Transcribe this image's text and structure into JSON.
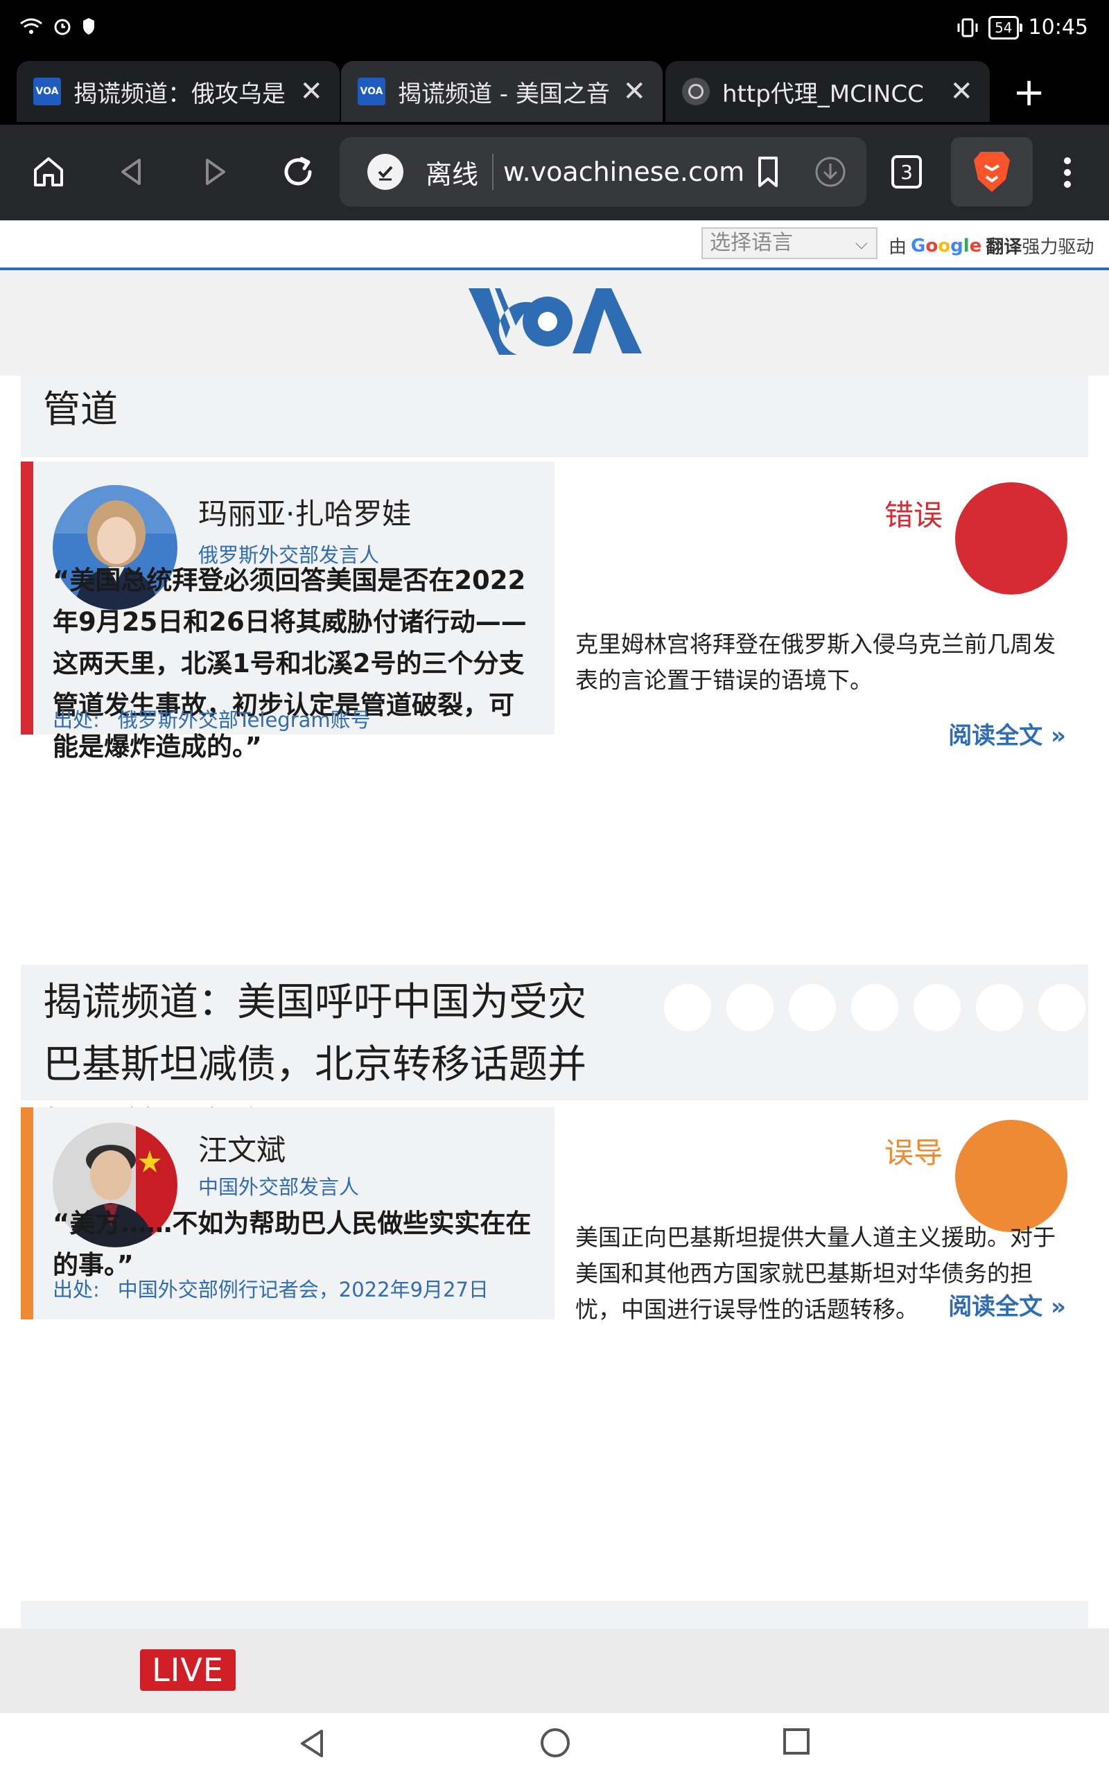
{
  "status_bar": {
    "time": "10:45",
    "battery": "54"
  },
  "tabs": [
    {
      "favicon": "VOA",
      "title": "揭谎频道：俄攻乌是",
      "close": "✕"
    },
    {
      "favicon": "VOA",
      "title": "揭谎频道 - 美国之音",
      "close": "✕"
    },
    {
      "favicon": "globe-icon",
      "title": "http代理_MCINCC",
      "close": "✕"
    }
  ],
  "toolbar": {
    "offline_label": "离线",
    "url": "w.voachinese.com",
    "tab_count": "3"
  },
  "translate": {
    "select_placeholder": "选择语言",
    "powered_by_prefix": "由",
    "google": "Google",
    "translate_bold": "翻译",
    "powered_by_suffix": "强力驱动"
  },
  "header": {
    "logo": "VOA"
  },
  "articles": [
    {
      "title_fragment": "管道",
      "speaker": {
        "name": "玛丽亚·扎哈罗娃",
        "role": "俄罗斯外交部发言人"
      },
      "quote": "“美国总统拜登必须回答美国是否在2022年9月25日和26日将其威胁付诸行动——这两天里，北溪1号和北溪2号的三个分支管道发生事故，初步认定是管道破裂，可能是爆炸造成的。”",
      "source_label": "出处:",
      "source": "俄罗斯外交部Telegram账号",
      "verdict": {
        "label": "错误",
        "color": "#d52b33"
      },
      "analysis": "克里姆林宫将拜登在俄罗斯入侵乌克兰前几周发表的言论置于错误的语境下。",
      "read_more": "阅读全文 »"
    },
    {
      "title": "揭谎频道：美国呼吁中国为受灾巴基斯坦减债，北京转移话题并扭曲美国角色",
      "speaker": {
        "name": "汪文斌",
        "role": "中国外交部发言人"
      },
      "quote": "“美方……不如为帮助巴人民做些实实在在的事。”",
      "source_label": "出处:",
      "source": "中国外交部例行记者会，2022年9月27日",
      "verdict": {
        "label": "误导",
        "color": "#ee8a33"
      },
      "analysis": "美国正向巴基斯坦提供大量人道主义援助。对于美国和其他西方国家就巴基斯坦对华债务的担忧，中国进行误导性的话题转移。",
      "read_more": "阅读全文 »"
    }
  ],
  "live": {
    "label": "LIVE"
  }
}
